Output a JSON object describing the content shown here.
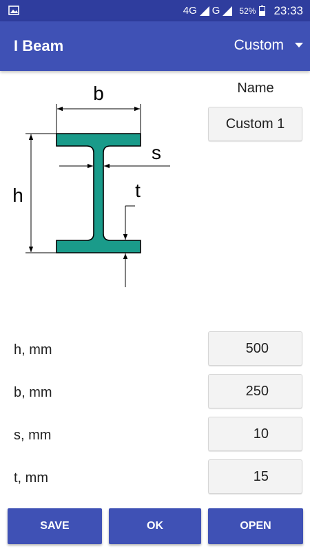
{
  "status_bar": {
    "network": "4G",
    "network2": "G",
    "battery": "52%",
    "time": "23:33"
  },
  "app_bar": {
    "title": "I Beam",
    "spinner_value": "Custom"
  },
  "diagram": {
    "label_b": "b",
    "label_h": "h",
    "label_s": "s",
    "label_t": "t",
    "beam_color": "#1a9b8a"
  },
  "name": {
    "label": "Name",
    "value": "Custom 1"
  },
  "params": [
    {
      "label": "h, mm",
      "value": "500"
    },
    {
      "label": "b, mm",
      "value": "250"
    },
    {
      "label": "s, mm",
      "value": "10"
    },
    {
      "label": "t, mm",
      "value": "15"
    }
  ],
  "buttons": {
    "save": "SAVE",
    "ok": "OK",
    "open": "OPEN"
  },
  "colors": {
    "primary": "#3f51b5",
    "primary_dark": "#2f3d9e"
  }
}
